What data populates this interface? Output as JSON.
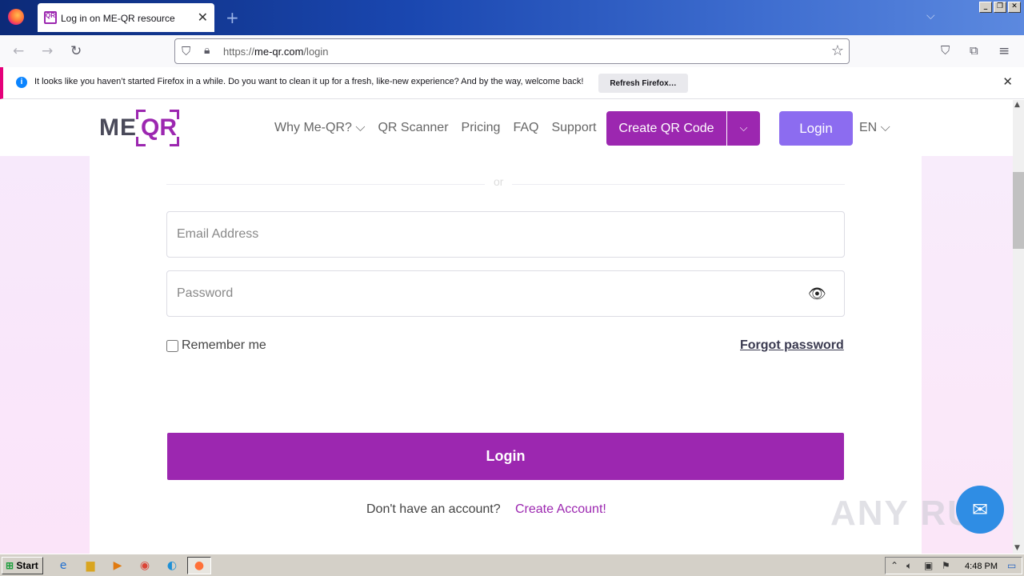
{
  "browser": {
    "tab_title": "Log in on ME-QR resource",
    "tab_favicon": "QR",
    "url_host": "me-qr.com",
    "url_prefix": "https://",
    "url_path": "/login",
    "notification_text": "It looks like you haven’t started Firefox in a while. Do you want to clean it up for a fresh, like-new experience? And by the way, welcome back!",
    "notification_button": "Refresh Firefox…",
    "window_buttons": [
      "_",
      "❐",
      "✕"
    ]
  },
  "site": {
    "logo_text": "ME",
    "logo_accent": "QR",
    "nav": [
      "Why Me-QR? ⌵",
      "QR Scanner",
      "Pricing",
      "FAQ",
      "Support"
    ],
    "create_button": "Create QR Code",
    "login_button": "Login",
    "language": "EN ⌵",
    "brand_color": "#9c27b0",
    "login_color": "#8c6cf0"
  },
  "form": {
    "divider_text": "or",
    "email_placeholder": "Email Address",
    "password_placeholder": "Password",
    "remember_label": "Remember me",
    "forgot_link": "Forgot password",
    "submit_label": "Login",
    "no_account_text": "Don't have an account?",
    "create_account_link": "Create Account!"
  },
  "watermark": "ANY RUN",
  "taskbar": {
    "start_label": "Start",
    "clock": "4:48 PM"
  }
}
